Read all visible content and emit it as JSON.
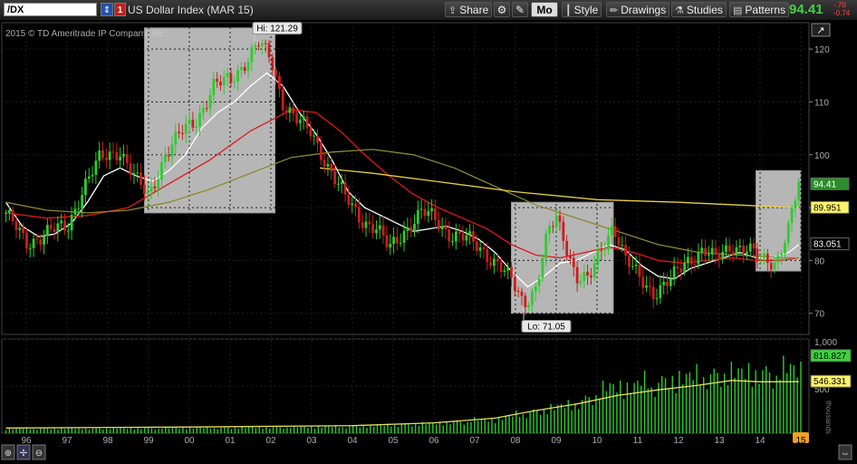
{
  "toolbar": {
    "symbol": "/DX",
    "link_badge": "1",
    "description": "US Dollar Index (MAR 15)",
    "share_label": "Share",
    "period_label": "Mo",
    "style_label": "Style",
    "drawings_label": "Drawings",
    "studies_label": "Studies",
    "patterns_label": "Patterns",
    "last_price": "94.41",
    "change_1": "-.70",
    "change_2": "-0.74",
    "colors": {
      "up": "#3fd43f",
      "down": "#ff4444"
    }
  },
  "chart_data": {
    "type": "candlestick",
    "copyright": "2015 © TD Ameritrade IP Company, Inc.",
    "price_axis": {
      "ticks": [
        "120",
        "110",
        "100",
        "90",
        "80",
        "70"
      ],
      "tick_values": [
        120,
        110,
        100,
        90,
        80,
        70
      ],
      "range": [
        66,
        125
      ]
    },
    "volume_axis": {
      "ticks": [
        "1,000",
        "500"
      ],
      "tick_values": [
        1000,
        500
      ],
      "range": [
        0,
        1000
      ],
      "unit": "thousands"
    },
    "x_axis": {
      "labels": [
        "96",
        "97",
        "98",
        "99",
        "00",
        "01",
        "02",
        "03",
        "04",
        "05",
        "06",
        "07",
        "08",
        "09",
        "10",
        "11",
        "12",
        "13",
        "14",
        "15"
      ],
      "label_years": [
        1996,
        1997,
        1998,
        1999,
        2000,
        2001,
        2002,
        2003,
        2004,
        2005,
        2006,
        2007,
        2008,
        2009,
        2010,
        2011,
        2012,
        2013,
        2014,
        2015
      ],
      "range_years": [
        1995.4,
        2015.2
      ]
    },
    "annotations": {
      "high": {
        "label": "Hi: 121.29",
        "year": 2001.6,
        "value": 121.29
      },
      "low": {
        "label": "Lo: 71.05",
        "year": 2008.2,
        "value": 71.05
      }
    },
    "highlight_boxes": [
      {
        "from": 1998.9,
        "to": 2002.1,
        "low": 89,
        "high": 124
      },
      {
        "from": 2007.9,
        "to": 2010.4,
        "low": 70,
        "high": 91
      },
      {
        "from": 2013.9,
        "to": 2015.0,
        "low": 78,
        "high": 97
      }
    ],
    "price_labels": [
      {
        "text": "94.41",
        "value": 94.41,
        "bg": "#2a8f2a",
        "fg": "#ffffff"
      },
      {
        "text": "89.951",
        "value": 89.951,
        "bg": "#fff36a",
        "fg": "#000000"
      },
      {
        "text": "83.051",
        "value": 83.051,
        "bg": "#000000",
        "fg": "#ffffff"
      }
    ],
    "volume_labels": [
      {
        "text": "818.827",
        "value": 818.827,
        "bg": "#3bd43b",
        "fg": "#000000"
      },
      {
        "text": "546.331",
        "value": 546.331,
        "bg": "#fff36a",
        "fg": "#000000"
      }
    ],
    "moving_averages": [
      {
        "color": "#ffffff",
        "points": [
          [
            1995.5,
            91
          ],
          [
            1995.9,
            86.5
          ],
          [
            1996.3,
            84.5
          ],
          [
            1996.7,
            85
          ],
          [
            1997.1,
            87
          ],
          [
            1997.5,
            91
          ],
          [
            1997.9,
            96
          ],
          [
            1998.3,
            97.5
          ],
          [
            1998.7,
            96
          ],
          [
            1999.1,
            95
          ],
          [
            1999.5,
            97
          ],
          [
            1999.9,
            100
          ],
          [
            2000.3,
            105
          ],
          [
            2000.7,
            108
          ],
          [
            2001.1,
            110
          ],
          [
            2001.5,
            113
          ],
          [
            2001.9,
            115.5
          ],
          [
            2002.3,
            113
          ],
          [
            2002.7,
            108
          ],
          [
            2003.1,
            104
          ],
          [
            2003.5,
            99
          ],
          [
            2003.9,
            93
          ],
          [
            2004.3,
            90
          ],
          [
            2004.7,
            88.5
          ],
          [
            2005.1,
            87
          ],
          [
            2005.5,
            85.5
          ],
          [
            2005.9,
            86
          ],
          [
            2006.3,
            86.5
          ],
          [
            2006.7,
            85.5
          ],
          [
            2007.1,
            84
          ],
          [
            2007.5,
            81.5
          ],
          [
            2007.9,
            78
          ],
          [
            2008.3,
            75
          ],
          [
            2008.7,
            77
          ],
          [
            2009.1,
            79.5
          ],
          [
            2009.5,
            80
          ],
          [
            2009.9,
            81.5
          ],
          [
            2010.3,
            83
          ],
          [
            2010.7,
            82
          ],
          [
            2011.1,
            79
          ],
          [
            2011.5,
            77
          ],
          [
            2011.9,
            76.5
          ],
          [
            2012.3,
            78.5
          ],
          [
            2012.7,
            79.5
          ],
          [
            2013.1,
            80.5
          ],
          [
            2013.5,
            81.5
          ],
          [
            2013.9,
            80.5
          ],
          [
            2014.3,
            80.5
          ],
          [
            2014.7,
            81.5
          ],
          [
            2014.95,
            83
          ]
        ]
      },
      {
        "color": "#e01818",
        "points": [
          [
            1995.5,
            89
          ],
          [
            1996.5,
            88
          ],
          [
            1997.5,
            88.5
          ],
          [
            1998.5,
            90
          ],
          [
            1999.5,
            94.5
          ],
          [
            2000.5,
            99
          ],
          [
            2001.5,
            104.5
          ],
          [
            2002.5,
            108.5
          ],
          [
            2003.1,
            108
          ],
          [
            2003.7,
            104.5
          ],
          [
            2004.3,
            100
          ],
          [
            2004.9,
            96
          ],
          [
            2005.5,
            92.5
          ],
          [
            2006.1,
            90
          ],
          [
            2006.7,
            88
          ],
          [
            2007.3,
            86
          ],
          [
            2007.9,
            83
          ],
          [
            2008.5,
            81
          ],
          [
            2009.1,
            80.5
          ],
          [
            2009.7,
            81.5
          ],
          [
            2010.3,
            82.5
          ],
          [
            2010.9,
            81.5
          ],
          [
            2011.5,
            80
          ],
          [
            2012.1,
            79.5
          ],
          [
            2012.7,
            80
          ],
          [
            2013.3,
            80.5
          ],
          [
            2013.9,
            80
          ],
          [
            2014.5,
            80
          ],
          [
            2014.95,
            80.5
          ]
        ]
      },
      {
        "color": "#8a8a30",
        "points": [
          [
            1995.5,
            91
          ],
          [
            1996.5,
            89.5
          ],
          [
            1997.5,
            89
          ],
          [
            1998.5,
            89.5
          ],
          [
            1999.5,
            91
          ],
          [
            2000.5,
            93.5
          ],
          [
            2001.5,
            96.5
          ],
          [
            2002.5,
            99.5
          ],
          [
            2003.5,
            100.5
          ],
          [
            2004.5,
            101
          ],
          [
            2005.5,
            100
          ],
          [
            2006.5,
            97.5
          ],
          [
            2007.5,
            94
          ],
          [
            2008.5,
            90.5
          ],
          [
            2009.5,
            88
          ],
          [
            2010.5,
            85.5
          ],
          [
            2011.5,
            83
          ],
          [
            2012.5,
            81.5
          ],
          [
            2013.5,
            81
          ],
          [
            2014.5,
            80.5
          ],
          [
            2014.95,
            80.5
          ]
        ]
      },
      {
        "color": "#e8d040",
        "points": [
          [
            2003.2,
            97.5
          ],
          [
            2004.5,
            96.5
          ],
          [
            2006,
            95
          ],
          [
            2008,
            93
          ],
          [
            2010,
            91.5
          ],
          [
            2012,
            91
          ],
          [
            2014,
            90.3
          ],
          [
            2014.95,
            90
          ]
        ]
      }
    ],
    "price_path": [
      [
        1995.5,
        89
      ],
      [
        1996.0,
        83
      ],
      [
        1996.5,
        85.5
      ],
      [
        1997.0,
        86
      ],
      [
        1997.4,
        94
      ],
      [
        1997.8,
        99
      ],
      [
        1998.3,
        101
      ],
      [
        1998.7,
        95
      ],
      [
        1999.0,
        92
      ],
      [
        1999.4,
        100
      ],
      [
        1999.8,
        104
      ],
      [
        2000.2,
        107
      ],
      [
        2000.6,
        113
      ],
      [
        2001.0,
        114
      ],
      [
        2001.4,
        118
      ],
      [
        2001.7,
        121
      ],
      [
        2002.0,
        118
      ],
      [
        2002.3,
        110
      ],
      [
        2002.7,
        106
      ],
      [
        2003.0,
        104
      ],
      [
        2003.4,
        98
      ],
      [
        2003.8,
        92
      ],
      [
        2004.2,
        88
      ],
      [
        2004.6,
        86
      ],
      [
        2004.9,
        82
      ],
      [
        2005.3,
        86
      ],
      [
        2005.7,
        89
      ],
      [
        2006.0,
        88
      ],
      [
        2006.4,
        85
      ],
      [
        2006.8,
        84
      ],
      [
        2007.2,
        82
      ],
      [
        2007.6,
        79
      ],
      [
        2007.9,
        76
      ],
      [
        2008.2,
        72
      ],
      [
        2008.5,
        75
      ],
      [
        2008.8,
        85
      ],
      [
        2009.0,
        88
      ],
      [
        2009.2,
        84
      ],
      [
        2009.5,
        77
      ],
      [
        2009.8,
        76
      ],
      [
        2010.1,
        82
      ],
      [
        2010.4,
        87
      ],
      [
        2010.7,
        80
      ],
      [
        2011.0,
        77
      ],
      [
        2011.4,
        74
      ],
      [
        2011.8,
        76
      ],
      [
        2012.2,
        80
      ],
      [
        2012.6,
        82
      ],
      [
        2012.9,
        80
      ],
      [
        2013.3,
        83
      ],
      [
        2013.7,
        82
      ],
      [
        2014.0,
        80
      ],
      [
        2014.4,
        80
      ],
      [
        2014.7,
        86
      ],
      [
        2014.95,
        94.41
      ]
    ],
    "volume_path": [
      [
        1995.5,
        60
      ],
      [
        2000,
        70
      ],
      [
        2004,
        90
      ],
      [
        2006,
        130
      ],
      [
        2007.5,
        190
      ],
      [
        2008.5,
        300
      ],
      [
        2009.5,
        400
      ],
      [
        2010.3,
        620
      ],
      [
        2011,
        650
      ],
      [
        2012,
        740
      ],
      [
        2013,
        800
      ],
      [
        2013.9,
        820
      ],
      [
        2014.5,
        830
      ],
      [
        2014.95,
        880
      ]
    ],
    "volume_ma": [
      [
        1995.5,
        55
      ],
      [
        2000,
        65
      ],
      [
        2004,
        80
      ],
      [
        2006,
        110
      ],
      [
        2007.5,
        160
      ],
      [
        2008.5,
        240
      ],
      [
        2009.5,
        310
      ],
      [
        2010.5,
        400
      ],
      [
        2011.5,
        460
      ],
      [
        2012.5,
        510
      ],
      [
        2013.3,
        560
      ],
      [
        2014.0,
        545
      ],
      [
        2014.95,
        546
      ]
    ]
  }
}
